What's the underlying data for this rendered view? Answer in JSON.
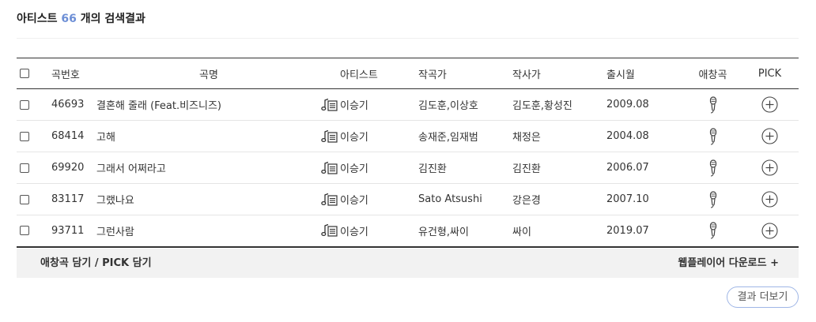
{
  "heading": {
    "prefix": "아티스트",
    "count": "66",
    "suffix": "개의 검색결과"
  },
  "columns": {
    "number": "곡번호",
    "title": "곡명",
    "artist": "아티스트",
    "composer": "작곡가",
    "lyricist": "작사가",
    "release": "출시월",
    "favorite": "애창곡",
    "pick": "PICK"
  },
  "rows": [
    {
      "number": "46693",
      "title": "결혼해 줄래 (Feat.비즈니즈)",
      "artist": "이승기",
      "composer": "김도훈,이상호",
      "lyricist": "김도훈,황성진",
      "release": "2009.08"
    },
    {
      "number": "68414",
      "title": "고해",
      "artist": "이승기",
      "composer": "송재준,임재범",
      "lyricist": "채정은",
      "release": "2004.08"
    },
    {
      "number": "69920",
      "title": "그래서 어쩌라고",
      "artist": "이승기",
      "composer": "김진환",
      "lyricist": "김진환",
      "release": "2006.07"
    },
    {
      "number": "83117",
      "title": "그랬나요",
      "artist": "이승기",
      "composer": "Sato Atsushi",
      "lyricist": "강은경",
      "release": "2007.10"
    },
    {
      "number": "93711",
      "title": "그런사람",
      "artist": "이승기",
      "composer": "유건형,싸이",
      "lyricist": "싸이",
      "release": "2019.07"
    }
  ],
  "actions": {
    "add_label": "애창곡 담기 / PICK 담기",
    "download_label": "웹플레이어 다운로드 +"
  },
  "more_button": "결과 더보기",
  "icons": {
    "lyrics": "lyrics-note-icon",
    "favorite": "microphone-icon",
    "pick": "plus-circle-icon"
  },
  "colors": {
    "count_accent": "#6d8fd6",
    "more_button_border": "#9fb6e6"
  }
}
